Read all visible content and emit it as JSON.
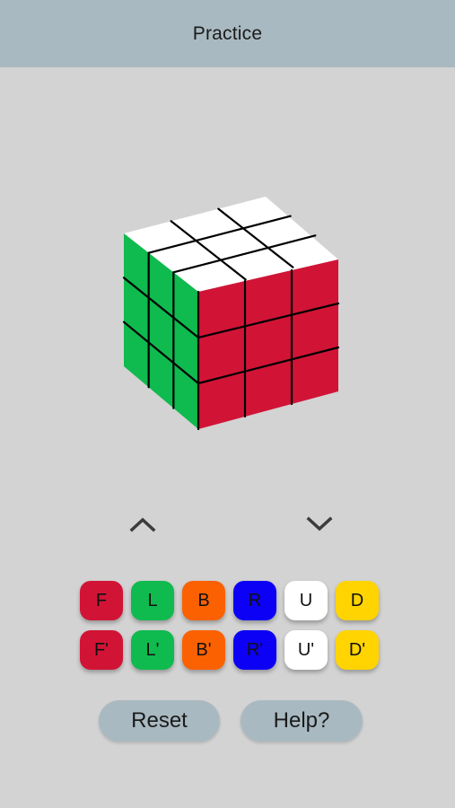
{
  "header": {
    "title": "Practice"
  },
  "cube": {
    "colors": {
      "top": "#ffffff",
      "front": "#d11436",
      "left": "#0fba4e",
      "edge": "#000000"
    }
  },
  "controls": {
    "up_icon": "chevron-up-icon",
    "down_icon": "chevron-down-icon"
  },
  "moves": [
    {
      "label": "F",
      "color": "#d11436"
    },
    {
      "label": "L",
      "color": "#0fba4e"
    },
    {
      "label": "B",
      "color": "#fb6100"
    },
    {
      "label": "R",
      "color": "#0c00f5"
    },
    {
      "label": "U",
      "color": "#ffffff"
    },
    {
      "label": "D",
      "color": "#ffd400"
    },
    {
      "label": "F'",
      "color": "#d11436"
    },
    {
      "label": "L'",
      "color": "#0fba4e"
    },
    {
      "label": "B'",
      "color": "#fb6100"
    },
    {
      "label": "R'",
      "color": "#0c00f5"
    },
    {
      "label": "U'",
      "color": "#ffffff"
    },
    {
      "label": "D'",
      "color": "#ffd400"
    }
  ],
  "buttons": {
    "reset": "Reset",
    "help": "Help?"
  }
}
